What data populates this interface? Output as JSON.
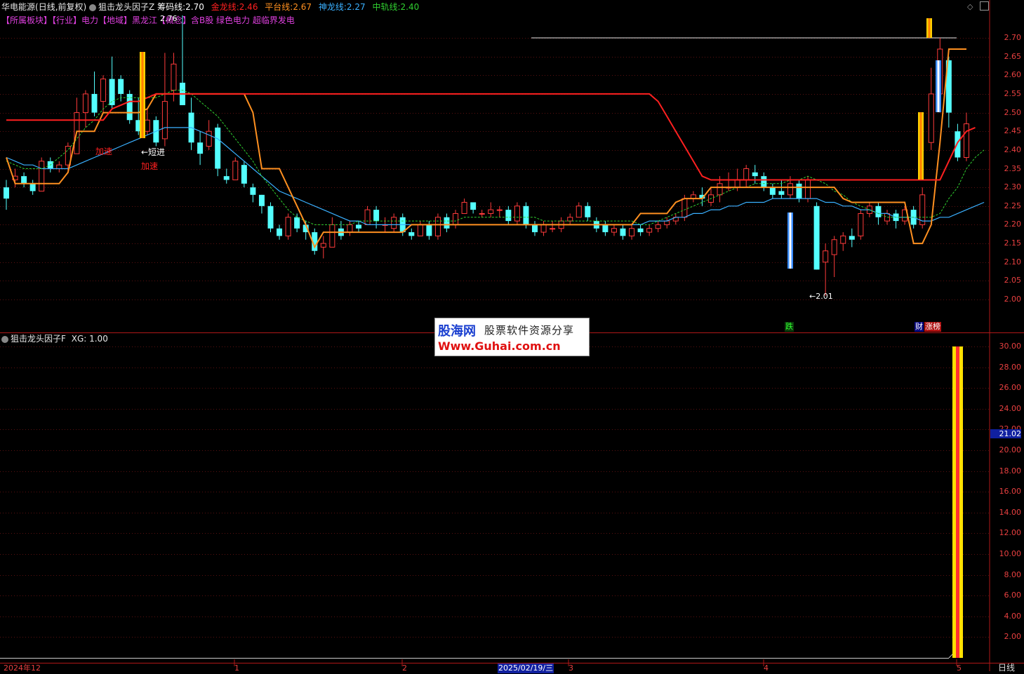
{
  "header": {
    "stock": "华电能源",
    "period": "(日线,前复权)",
    "indicator": "狙击龙头因子Z",
    "chip_label": "筹码线:",
    "chip_value": "2.70",
    "gold_label": "金龙线:",
    "gold_value": "2.46",
    "plat_label": "平台线:",
    "plat_value": "2.67",
    "shen_label": "神龙线:",
    "shen_value": "2.27",
    "mid_label": "中轨线:",
    "mid_value": "2.40"
  },
  "sectors": {
    "text": "【所属板块】【行业】电力【地域】黑龙江【概念】含B股 绿色电力 超临界发电"
  },
  "annotations": {
    "accel1": "加速",
    "short": "←短进",
    "accel2": "加速",
    "high": "2.76",
    "low": "←2.01",
    "fall": "跌",
    "cai": "财",
    "zhang": "涨榜"
  },
  "lower": {
    "indicator": "狙击龙头因子F",
    "xg": "XG: 1.00",
    "highlight": "21.02"
  },
  "watermark": {
    "t1": "股海网",
    "t2": "股票软件资源分享",
    "t3": "Www.Guhai.com.cn"
  },
  "xaxis": {
    "start": "2024年12",
    "m1": "1",
    "m2": "2",
    "cursor": "2025/02/19/三",
    "m3": "3",
    "m4": "4",
    "m5": "5",
    "period_btn": "日线"
  },
  "yaxis_upper": [
    "2.70",
    "2.65",
    "2.60",
    "2.55",
    "2.50",
    "2.45",
    "2.40",
    "2.35",
    "2.30",
    "2.25",
    "2.20",
    "2.15",
    "2.10",
    "2.05",
    "2.00"
  ],
  "yaxis_lower": [
    "30.00",
    "28.00",
    "26.00",
    "24.00",
    "22.00",
    "20.00",
    "18.00",
    "16.00",
    "14.00",
    "12.00",
    "10.00",
    "8.00",
    "6.00",
    "4.00",
    "2.00"
  ],
  "colors": {
    "up": "#ff3b3b",
    "down": "#54ffff",
    "gold": "#ff2020",
    "plat": "#ff9020",
    "shen": "#3ab0ff",
    "mid": "#30d030",
    "bg": "#000000"
  },
  "chart_data": {
    "type": "candlestick",
    "ylim": [
      1.97,
      2.77
    ],
    "candles": [
      [
        2.3,
        2.27,
        2.32,
        2.24
      ],
      [
        2.32,
        2.33,
        2.35,
        2.3
      ],
      [
        2.33,
        2.31,
        2.34,
        2.3
      ],
      [
        2.31,
        2.29,
        2.32,
        2.28
      ],
      [
        2.29,
        2.37,
        2.38,
        2.29
      ],
      [
        2.37,
        2.35,
        2.38,
        2.34
      ],
      [
        2.35,
        2.36,
        2.37,
        2.34
      ],
      [
        2.36,
        2.41,
        2.42,
        2.34
      ],
      [
        2.39,
        2.5,
        2.54,
        2.39
      ],
      [
        2.5,
        2.55,
        2.56,
        2.46
      ],
      [
        2.55,
        2.5,
        2.61,
        2.49
      ],
      [
        2.53,
        2.59,
        2.6,
        2.5
      ],
      [
        2.59,
        2.52,
        2.65,
        2.51
      ],
      [
        2.59,
        2.55,
        2.6,
        2.53
      ],
      [
        2.55,
        2.48,
        2.56,
        2.47
      ],
      [
        2.48,
        2.45,
        2.54,
        2.44
      ],
      [
        2.45,
        2.48,
        2.51,
        2.44
      ],
      [
        2.48,
        2.42,
        2.49,
        2.41
      ],
      [
        2.43,
        2.53,
        2.66,
        2.41
      ],
      [
        2.56,
        2.63,
        2.66,
        2.53
      ],
      [
        2.58,
        2.52,
        2.76,
        2.52
      ],
      [
        2.5,
        2.42,
        2.54,
        2.4
      ],
      [
        2.42,
        2.39,
        2.45,
        2.36
      ],
      [
        2.41,
        2.45,
        2.48,
        2.4
      ],
      [
        2.46,
        2.35,
        2.47,
        2.33
      ],
      [
        2.33,
        2.32,
        2.35,
        2.31
      ],
      [
        2.32,
        2.37,
        2.38,
        2.32
      ],
      [
        2.36,
        2.31,
        2.37,
        2.3
      ],
      [
        2.3,
        2.28,
        2.31,
        2.26
      ],
      [
        2.28,
        2.25,
        2.28,
        2.23
      ],
      [
        2.25,
        2.19,
        2.26,
        2.18
      ],
      [
        2.19,
        2.17,
        2.2,
        2.16
      ],
      [
        2.17,
        2.22,
        2.23,
        2.16
      ],
      [
        2.22,
        2.19,
        2.23,
        2.18
      ],
      [
        2.2,
        2.18,
        2.21,
        2.16
      ],
      [
        2.18,
        2.13,
        2.19,
        2.12
      ],
      [
        2.14,
        2.15,
        2.17,
        2.11
      ],
      [
        2.14,
        2.2,
        2.22,
        2.14
      ],
      [
        2.19,
        2.17,
        2.21,
        2.16
      ],
      [
        2.18,
        2.2,
        2.21,
        2.17
      ],
      [
        2.2,
        2.19,
        2.21,
        2.18
      ],
      [
        2.2,
        2.24,
        2.25,
        2.2
      ],
      [
        2.24,
        2.21,
        2.25,
        2.19
      ],
      [
        2.2,
        2.2,
        2.22,
        2.18
      ],
      [
        2.19,
        2.22,
        2.23,
        2.18
      ],
      [
        2.22,
        2.18,
        2.23,
        2.17
      ],
      [
        2.18,
        2.17,
        2.19,
        2.16
      ],
      [
        2.17,
        2.2,
        2.21,
        2.17
      ],
      [
        2.2,
        2.17,
        2.21,
        2.16
      ],
      [
        2.17,
        2.22,
        2.23,
        2.16
      ],
      [
        2.22,
        2.19,
        2.23,
        2.18
      ],
      [
        2.2,
        2.23,
        2.24,
        2.19
      ],
      [
        2.23,
        2.26,
        2.27,
        2.23
      ],
      [
        2.26,
        2.24,
        2.26,
        2.23
      ],
      [
        2.23,
        2.23,
        2.24,
        2.22
      ],
      [
        2.23,
        2.24,
        2.26,
        2.22
      ],
      [
        2.24,
        2.24,
        2.25,
        2.22
      ],
      [
        2.24,
        2.21,
        2.25,
        2.2
      ],
      [
        2.21,
        2.25,
        2.26,
        2.2
      ],
      [
        2.25,
        2.2,
        2.26,
        2.19
      ],
      [
        2.2,
        2.18,
        2.21,
        2.17
      ],
      [
        2.18,
        2.2,
        2.21,
        2.17
      ],
      [
        2.19,
        2.19,
        2.21,
        2.18
      ],
      [
        2.19,
        2.21,
        2.22,
        2.18
      ],
      [
        2.21,
        2.22,
        2.23,
        2.2
      ],
      [
        2.22,
        2.25,
        2.26,
        2.22
      ],
      [
        2.25,
        2.22,
        2.26,
        2.21
      ],
      [
        2.21,
        2.19,
        2.22,
        2.18
      ],
      [
        2.2,
        2.18,
        2.21,
        2.17
      ],
      [
        2.18,
        2.19,
        2.2,
        2.17
      ],
      [
        2.19,
        2.17,
        2.2,
        2.16
      ],
      [
        2.17,
        2.19,
        2.2,
        2.16
      ],
      [
        2.19,
        2.18,
        2.2,
        2.17
      ],
      [
        2.18,
        2.19,
        2.2,
        2.17
      ],
      [
        2.19,
        2.2,
        2.21,
        2.18
      ],
      [
        2.2,
        2.21,
        2.22,
        2.19
      ],
      [
        2.21,
        2.22,
        2.23,
        2.2
      ],
      [
        2.22,
        2.27,
        2.28,
        2.21
      ],
      [
        2.27,
        2.28,
        2.29,
        2.26
      ],
      [
        2.28,
        2.27,
        2.3,
        2.25
      ],
      [
        2.26,
        2.28,
        2.3,
        2.25
      ],
      [
        2.28,
        2.31,
        2.33,
        2.26
      ],
      [
        2.3,
        2.3,
        2.34,
        2.29
      ],
      [
        2.3,
        2.32,
        2.35,
        2.29
      ],
      [
        2.32,
        2.35,
        2.36,
        2.3
      ],
      [
        2.34,
        2.33,
        2.36,
        2.31
      ],
      [
        2.33,
        2.3,
        2.34,
        2.29
      ],
      [
        2.3,
        2.28,
        2.31,
        2.27
      ],
      [
        2.29,
        2.28,
        2.32,
        2.27
      ],
      [
        2.28,
        2.31,
        2.33,
        2.27
      ],
      [
        2.31,
        2.27,
        2.32,
        2.26
      ],
      [
        2.27,
        2.32,
        2.33,
        2.26
      ],
      [
        2.25,
        2.08,
        2.26,
        2.08
      ],
      [
        2.1,
        2.13,
        2.15,
        2.01
      ],
      [
        2.12,
        2.16,
        2.17,
        2.06
      ],
      [
        2.15,
        2.17,
        2.18,
        2.13
      ],
      [
        2.17,
        2.16,
        2.19,
        2.14
      ],
      [
        2.17,
        2.23,
        2.24,
        2.16
      ],
      [
        2.23,
        2.25,
        2.26,
        2.22
      ],
      [
        2.25,
        2.22,
        2.26,
        2.2
      ],
      [
        2.21,
        2.23,
        2.24,
        2.2
      ],
      [
        2.23,
        2.21,
        2.24,
        2.19
      ],
      [
        2.21,
        2.24,
        2.25,
        2.2
      ],
      [
        2.24,
        2.2,
        2.25,
        2.19
      ],
      [
        2.2,
        2.28,
        2.3,
        2.19
      ],
      [
        2.42,
        2.55,
        2.62,
        2.4
      ],
      [
        2.55,
        2.67,
        2.7,
        2.5
      ],
      [
        2.64,
        2.5,
        2.65,
        2.46
      ],
      [
        2.45,
        2.38,
        2.47,
        2.37
      ],
      [
        2.38,
        2.47,
        2.5,
        2.37
      ]
    ],
    "gold_line": [
      2.48,
      2.48,
      2.48,
      2.48,
      2.48,
      2.48,
      2.48,
      2.48,
      2.48,
      2.48,
      2.48,
      2.48,
      2.51,
      2.52,
      2.53,
      2.53,
      2.54,
      2.55,
      2.55,
      2.55,
      2.55,
      2.55,
      2.55,
      2.55,
      2.55,
      2.55,
      2.55,
      2.55,
      2.55,
      2.55,
      2.55,
      2.55,
      2.55,
      2.55,
      2.55,
      2.55,
      2.55,
      2.55,
      2.55,
      2.55,
      2.55,
      2.55,
      2.55,
      2.55,
      2.55,
      2.55,
      2.55,
      2.55,
      2.55,
      2.55,
      2.55,
      2.55,
      2.55,
      2.55,
      2.55,
      2.55,
      2.55,
      2.55,
      2.55,
      2.55,
      2.55,
      2.55,
      2.55,
      2.55,
      2.55,
      2.55,
      2.55,
      2.55,
      2.55,
      2.55,
      2.55,
      2.55,
      2.55,
      2.55,
      2.53,
      2.49,
      2.45,
      2.41,
      2.37,
      2.33,
      2.32,
      2.32,
      2.32,
      2.32,
      2.32,
      2.32,
      2.32,
      2.32,
      2.32,
      2.32,
      2.32,
      2.32,
      2.32,
      2.32,
      2.32,
      2.32,
      2.32,
      2.32,
      2.32,
      2.32,
      2.32,
      2.32,
      2.32,
      2.32,
      2.32,
      2.32,
      2.32,
      2.37,
      2.42,
      2.45,
      2.46
    ],
    "plat_line": [
      2.38,
      2.31,
      2.31,
      2.31,
      2.31,
      2.31,
      2.31,
      2.34,
      2.45,
      2.45,
      2.45,
      2.5,
      2.5,
      2.5,
      2.5,
      2.5,
      2.51,
      2.55,
      2.55,
      2.55,
      2.55,
      2.55,
      2.55,
      2.55,
      2.55,
      2.55,
      2.55,
      2.55,
      2.5,
      2.35,
      2.35,
      2.35,
      2.3,
      2.25,
      2.2,
      2.14,
      2.18,
      2.18,
      2.18,
      2.18,
      2.18,
      2.18,
      2.18,
      2.18,
      2.18,
      2.18,
      2.2,
      2.2,
      2.2,
      2.2,
      2.2,
      2.2,
      2.2,
      2.2,
      2.2,
      2.2,
      2.2,
      2.2,
      2.2,
      2.2,
      2.2,
      2.2,
      2.2,
      2.2,
      2.2,
      2.2,
      2.2,
      2.2,
      2.2,
      2.2,
      2.2,
      2.2,
      2.23,
      2.23,
      2.23,
      2.23,
      2.26,
      2.27,
      2.27,
      2.27,
      2.3,
      2.3,
      2.3,
      2.3,
      2.3,
      2.3,
      2.3,
      2.3,
      2.3,
      2.3,
      2.3,
      2.3,
      2.3,
      2.3,
      2.3,
      2.27,
      2.26,
      2.26,
      2.26,
      2.26,
      2.26,
      2.26,
      2.26,
      2.15,
      2.15,
      2.2,
      2.42,
      2.67,
      2.67,
      2.67
    ],
    "shen_line": [
      2.38,
      2.37,
      2.36,
      2.36,
      2.35,
      2.35,
      2.35,
      2.35,
      2.36,
      2.37,
      2.38,
      2.39,
      2.4,
      2.41,
      2.42,
      2.43,
      2.44,
      2.45,
      2.46,
      2.46,
      2.46,
      2.46,
      2.45,
      2.44,
      2.43,
      2.41,
      2.39,
      2.37,
      2.35,
      2.33,
      2.31,
      2.29,
      2.28,
      2.27,
      2.26,
      2.25,
      2.24,
      2.23,
      2.22,
      2.21,
      2.21,
      2.2,
      2.2,
      2.2,
      2.2,
      2.2,
      2.2,
      2.2,
      2.2,
      2.2,
      2.2,
      2.2,
      2.2,
      2.2,
      2.2,
      2.2,
      2.2,
      2.2,
      2.2,
      2.2,
      2.2,
      2.2,
      2.2,
      2.2,
      2.2,
      2.2,
      2.2,
      2.2,
      2.2,
      2.2,
      2.2,
      2.2,
      2.2,
      2.21,
      2.21,
      2.21,
      2.22,
      2.22,
      2.23,
      2.23,
      2.24,
      2.24,
      2.25,
      2.25,
      2.26,
      2.26,
      2.26,
      2.27,
      2.27,
      2.27,
      2.27,
      2.27,
      2.27,
      2.26,
      2.26,
      2.25,
      2.25,
      2.24,
      2.24,
      2.23,
      2.23,
      2.22,
      2.22,
      2.22,
      2.21,
      2.21,
      2.22,
      2.22,
      2.23,
      2.24,
      2.25,
      2.26
    ],
    "mid_line": [
      2.37,
      2.36,
      2.35,
      2.35,
      2.35,
      2.36,
      2.38,
      2.4,
      2.43,
      2.46,
      2.48,
      2.51,
      2.53,
      2.54,
      2.54,
      2.54,
      2.54,
      2.54,
      2.55,
      2.56,
      2.56,
      2.55,
      2.53,
      2.51,
      2.49,
      2.46,
      2.43,
      2.4,
      2.37,
      2.33,
      2.3,
      2.27,
      2.24,
      2.22,
      2.21,
      2.2,
      2.2,
      2.2,
      2.2,
      2.2,
      2.21,
      2.21,
      2.21,
      2.21,
      2.21,
      2.21,
      2.21,
      2.21,
      2.21,
      2.21,
      2.21,
      2.21,
      2.22,
      2.22,
      2.22,
      2.22,
      2.22,
      2.22,
      2.22,
      2.22,
      2.22,
      2.21,
      2.21,
      2.21,
      2.21,
      2.21,
      2.21,
      2.21,
      2.21,
      2.21,
      2.21,
      2.21,
      2.2,
      2.2,
      2.21,
      2.22,
      2.23,
      2.24,
      2.25,
      2.26,
      2.27,
      2.28,
      2.29,
      2.3,
      2.3,
      2.31,
      2.31,
      2.31,
      2.31,
      2.32,
      2.32,
      2.33,
      2.32,
      2.31,
      2.29,
      2.28,
      2.26,
      2.25,
      2.24,
      2.23,
      2.22,
      2.22,
      2.22,
      2.22,
      2.22,
      2.22,
      2.23,
      2.27,
      2.3,
      2.35,
      2.38,
      2.4
    ],
    "signal_bars_lower": [
      {
        "index": 109,
        "value": 30.0
      }
    ]
  }
}
